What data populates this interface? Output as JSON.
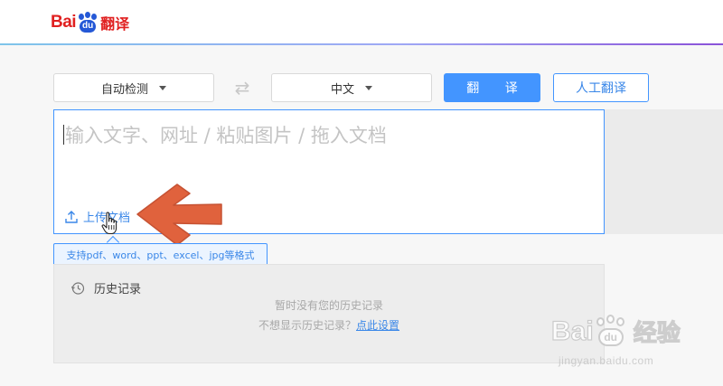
{
  "header": {
    "logo_bai": "Bai",
    "logo_du": "du",
    "logo_product": "翻译"
  },
  "toolbar": {
    "source_lang": "自动检测",
    "target_lang": "中文",
    "swap_icon": "swap-arrows-icon",
    "translate_button": "翻 译",
    "human_translate_button": "人工翻译"
  },
  "input": {
    "placeholder": "输入文字、网址 / 粘贴图片 / 拖入文档",
    "upload_link": "上传文档",
    "upload_icon": "upload-icon"
  },
  "tooltip": {
    "text": "支持pdf、word、ppt、excel、jpg等格式"
  },
  "history": {
    "title": "历史记录",
    "icon": "clock-icon",
    "empty_text": "暂时没有您的历史记录",
    "hint_prefix": "不想显示历史记录？",
    "hint_link": "点此设置"
  },
  "annotation": {
    "arrow_color": "#e0623d"
  },
  "watermark": {
    "brand_bai": "Bai",
    "brand_du": "du",
    "brand_jingyan": "经验",
    "url": "jingyan.baidu.com"
  },
  "colors": {
    "accent": "#4395ff",
    "brand_red": "#e02020",
    "brand_blue": "#2458d6"
  }
}
